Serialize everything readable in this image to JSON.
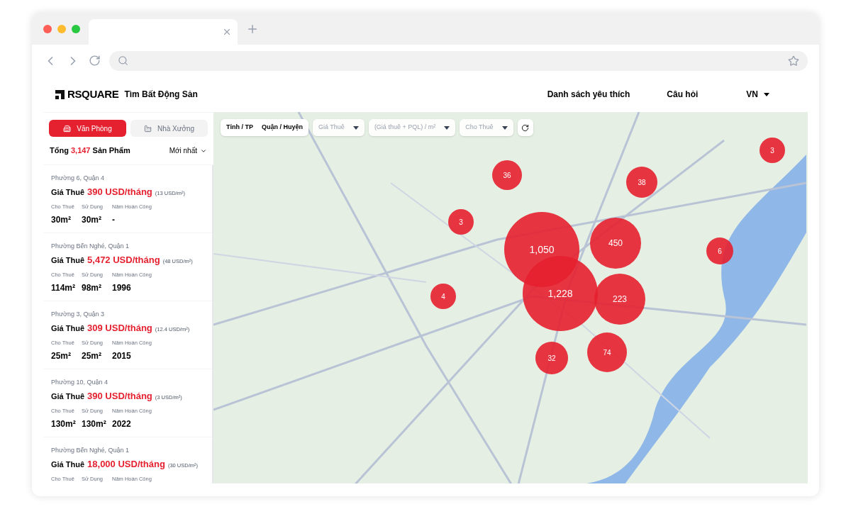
{
  "brand": {
    "logo": "RSQUARE",
    "tagline": "Tìm Bất Động Sản"
  },
  "nav": [
    {
      "label": "Danh sách yêu thích",
      "kind": "link"
    },
    {
      "label": "Câu hỏi",
      "kind": "link"
    },
    {
      "label": "VN",
      "kind": "dropdown"
    }
  ],
  "categories": [
    {
      "label": "Văn Phòng",
      "selected": true,
      "kind": "office"
    },
    {
      "label": "Nhà Xưởng",
      "selected": false,
      "kind": "factory"
    }
  ],
  "summary": {
    "prefix": "Tổng",
    "count": "3,147",
    "suffix": "Sản Phẩm",
    "sort": "Mới nhất"
  },
  "listings": [
    {
      "location": "Phường 6, Quận 4",
      "price_label": "Giá Thuê",
      "price": "390 USD/tháng",
      "unit_price": "(13 USD/m²)",
      "headers": [
        "Cho Thuê",
        "Sử Dụng",
        "Năm Hoàn Công"
      ],
      "values": [
        "30m²",
        "30m²",
        "-"
      ]
    },
    {
      "location": "Phường Bến Nghé, Quận 1",
      "price_label": "Giá Thuê",
      "price": "5,472 USD/tháng",
      "unit_price": "(48 USD/m²)",
      "headers": [
        "Cho Thuê",
        "Sử Dụng",
        "Năm Hoàn Công"
      ],
      "values": [
        "114m²",
        "98m²",
        "1996"
      ]
    },
    {
      "location": "Phường 3, Quận 3",
      "price_label": "Giá Thuê",
      "price": "309 USD/tháng",
      "unit_price": "(12.4 USD/m²)",
      "headers": [
        "Cho Thuê",
        "Sử Dụng",
        "Năm Hoàn Công"
      ],
      "values": [
        "25m²",
        "25m²",
        "2015"
      ]
    },
    {
      "location": "Phường 10, Quận 4",
      "price_label": "Giá Thuê",
      "price": "390 USD/tháng",
      "unit_price": "(3 USD/m²)",
      "headers": [
        "Cho Thuê",
        "Sử Dụng",
        "Năm Hoàn Công"
      ],
      "values": [
        "130m²",
        "130m²",
        "2022"
      ]
    },
    {
      "location": "Phường Bến Nghé, Quận 1",
      "price_label": "Giá Thuê",
      "price": "18,000 USD/tháng",
      "unit_price": "(30 USD/m²)",
      "headers": [
        "Cho Thuê",
        "Sử Dụng",
        "Năm Hoàn Công"
      ]
    }
  ],
  "filters": {
    "region": [
      "Tỉnh / TP",
      "Quận / Huyện"
    ],
    "dropdowns": [
      {
        "label": "Giá Thuê"
      },
      {
        "label": "(Giá thuê + PQL) / m²"
      },
      {
        "label": "Cho Thuê"
      }
    ]
  },
  "clusters": [
    {
      "count": "3"
    },
    {
      "count": "36"
    },
    {
      "count": "38"
    },
    {
      "count": "3"
    },
    {
      "count": "1,050"
    },
    {
      "count": "450"
    },
    {
      "count": "6"
    },
    {
      "count": "4"
    },
    {
      "count": "1,228"
    },
    {
      "count": "223"
    },
    {
      "count": "74"
    },
    {
      "count": "32"
    }
  ]
}
